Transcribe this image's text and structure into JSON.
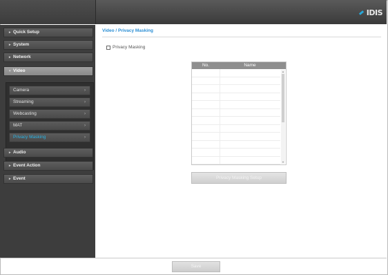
{
  "header": {
    "logo_text": "IDIS"
  },
  "sidebar": {
    "items": [
      {
        "label": "Quick Setup"
      },
      {
        "label": "System"
      },
      {
        "label": "Network"
      },
      {
        "label": "Video"
      },
      {
        "label": "Audio"
      },
      {
        "label": "Event Action"
      },
      {
        "label": "Event"
      }
    ],
    "video_submenu": [
      {
        "label": "Camera"
      },
      {
        "label": "Streaming"
      },
      {
        "label": "Webcasting"
      },
      {
        "label": "MAT"
      },
      {
        "label": "Privacy Masking"
      }
    ]
  },
  "main": {
    "breadcrumb": "Video / Privacy Masking",
    "enable_label": "Privacy Masking",
    "table": {
      "col_no": "No.",
      "col_name": "Name"
    },
    "button_label": "Privacy Masking Setup",
    "save_label": "Save"
  },
  "colors": {
    "accent": "#27b3e5",
    "sidebar_bg": "#3d3d3d",
    "header_bg": "#4a4a4a"
  }
}
